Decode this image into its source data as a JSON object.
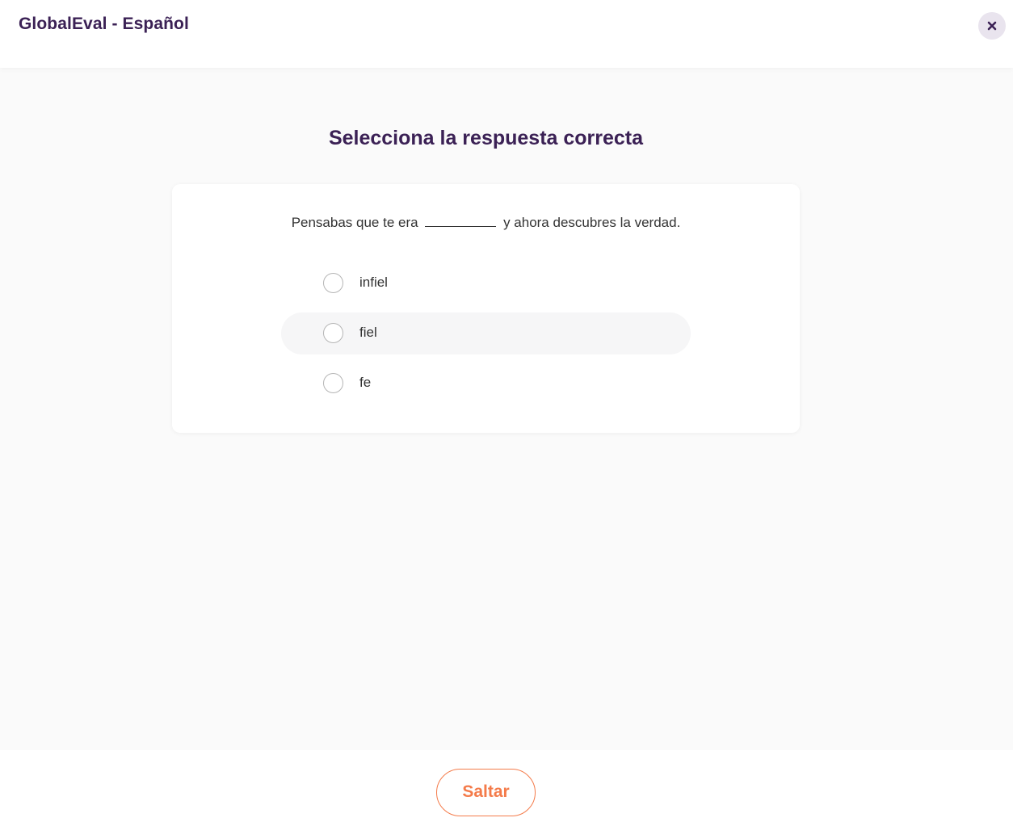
{
  "header": {
    "title": "GlobalEval - Español",
    "close_icon": "close-icon"
  },
  "question": {
    "title": "Selecciona la respuesta correcta",
    "prompt_before": "Pensabas que te era",
    "prompt_after": "y ahora descubres la verdad.",
    "options": [
      {
        "label": "infiel",
        "selected": false
      },
      {
        "label": "fiel",
        "selected": false
      },
      {
        "label": "fe",
        "selected": false
      }
    ]
  },
  "footer": {
    "skip_label": "Saltar"
  },
  "colors": {
    "brand_purple": "#3b2155",
    "accent_orange": "#f47b4a",
    "background": "#fafafa"
  }
}
